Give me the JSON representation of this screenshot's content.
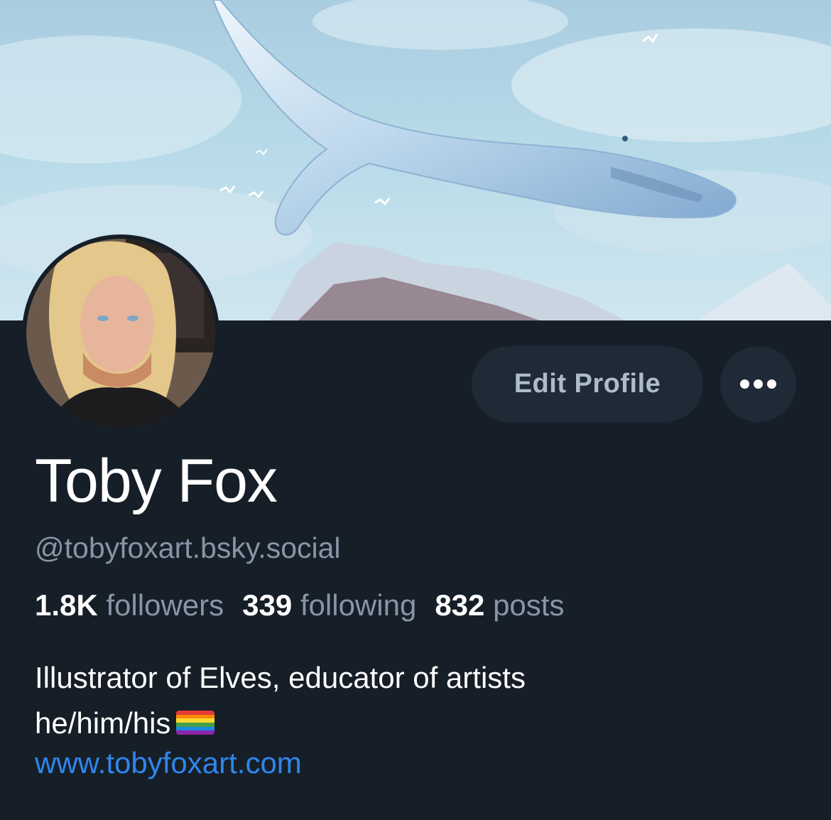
{
  "profile": {
    "display_name": "Toby Fox",
    "handle": "@tobyfoxart.bsky.social",
    "stats": {
      "followers_count": "1.8K",
      "followers_label": "followers",
      "following_count": "339",
      "following_label": "following",
      "posts_count": "832",
      "posts_label": "posts"
    },
    "bio_line1": "Illustrator of Elves, educator of artists",
    "bio_line2": "he/him/his",
    "link": "www.tobyfoxart.com",
    "flag_emoji": "rainbow-flag"
  },
  "actions": {
    "edit_profile_label": "Edit Profile",
    "more_icon": "ellipsis-icon"
  },
  "colors": {
    "background": "#161e27",
    "button_bg": "#1e2a36",
    "muted_text": "#8796a6",
    "link": "#2f86ec"
  }
}
